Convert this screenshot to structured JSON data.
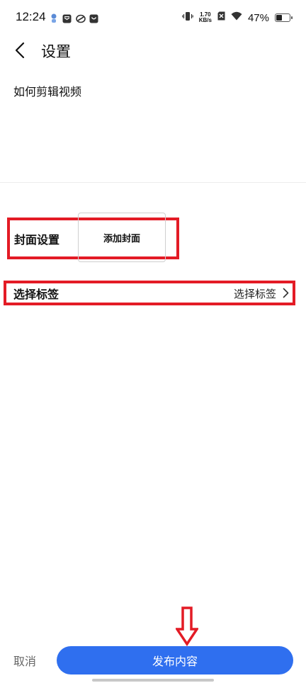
{
  "status_bar": {
    "time": "12:24",
    "net_speed_value": "1.70",
    "net_speed_unit": "KB/s",
    "battery_percent": "47%",
    "battery_level": 0.47,
    "icons": [
      "app-notification-icon",
      "mail-icon",
      "sync-icon",
      "bag-icon",
      "vibrate-icon",
      "no-sim-icon",
      "wifi-icon",
      "battery-icon"
    ]
  },
  "header": {
    "title": "设置",
    "back_icon": "chevron-left-icon"
  },
  "video": {
    "title": "如何剪辑视频"
  },
  "cover": {
    "label": "封面设置",
    "button_text": "添加封面"
  },
  "tags": {
    "label": "选择标签",
    "value": "选择标签",
    "chevron_icon": "chevron-right-icon"
  },
  "footer": {
    "cancel_label": "取消",
    "publish_label": "发布内容"
  },
  "colors": {
    "accent": "#2f6fef",
    "annotation": "#e31b25"
  }
}
